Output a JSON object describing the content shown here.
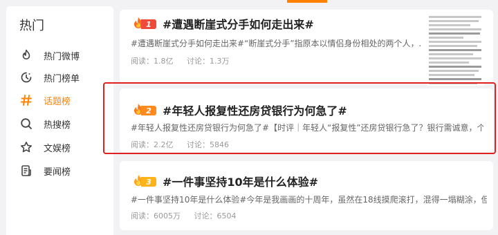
{
  "sidebar": {
    "title": "热门",
    "items": [
      {
        "label": "热门微博",
        "icon": "flame-icon",
        "active": false
      },
      {
        "label": "热门榜单",
        "icon": "clock-icon",
        "active": false
      },
      {
        "label": "话题榜",
        "icon": "hashtag-icon",
        "active": true
      },
      {
        "label": "热搜榜",
        "icon": "search-icon",
        "active": false
      },
      {
        "label": "文娱榜",
        "icon": "star-icon",
        "active": false
      },
      {
        "label": "要闻榜",
        "icon": "news-icon",
        "active": false
      }
    ]
  },
  "topics": [
    {
      "rank": "1",
      "title": "#遭遇断崖式分手如何走出来#",
      "desc": "#遭遇断崖式分手如何走出来#“断崖式分手”指原本以情侣身份相处的两个人，...",
      "reads_label": "阅读：1.8亿",
      "discuss_label": "讨论：1.3万",
      "badge_color": "#f04a3a"
    },
    {
      "rank": "2",
      "title": "#年轻人报复性还房贷银行为何急了#",
      "desc": "#年轻人报复性还房贷银行为何急了#【时评｜年轻人“报复性”还房贷银行急了？银行需诚意，个...",
      "reads_label": "阅读：2.2亿",
      "discuss_label": "讨论：5846",
      "badge_color": "#ff8a1e"
    },
    {
      "rank": "3",
      "title": "#一件事坚持10年是什么体验#",
      "desc": "#一件事坚持10年是什么体验#今年是我画画的十周年，虽然在18线摸爬滚打，混得一塌糊涂，但...",
      "reads_label": "阅读：6005万",
      "discuss_label": "讨论：6504",
      "badge_color": "#ffb31a"
    }
  ],
  "colors": {
    "accent": "#ff8200",
    "highlight": "#e02020"
  }
}
